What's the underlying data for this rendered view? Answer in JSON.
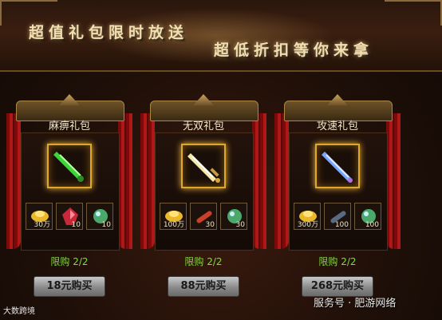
{
  "banner": {
    "line1": "超值礼包限时放送",
    "line2": "超低折扣等你来拿"
  },
  "packs": [
    {
      "name": "麻痹礼包",
      "items": [
        {
          "icon": "gold-ingot",
          "count": "30万"
        },
        {
          "icon": "red-gem",
          "count": "10"
        },
        {
          "icon": "orb",
          "count": "10"
        }
      ],
      "limit": "限购 2/2",
      "price": "18元购买",
      "accent": "#3cd43c"
    },
    {
      "name": "无双礼包",
      "items": [
        {
          "icon": "gold-ingot",
          "count": "100万"
        },
        {
          "icon": "red-stick",
          "count": "30"
        },
        {
          "icon": "orb",
          "count": "30"
        }
      ],
      "limit": "限购 2/2",
      "price": "88元购买",
      "accent": "#f6e6a8"
    },
    {
      "name": "攻速礼包",
      "items": [
        {
          "icon": "gold-ingot",
          "count": "300万"
        },
        {
          "icon": "dark-stick",
          "count": "100"
        },
        {
          "icon": "orb",
          "count": "100"
        }
      ],
      "limit": "限购 2/2",
      "price": "268元购买",
      "accent": "#7aa8ff"
    }
  ],
  "watermark": {
    "left": "大数跨境",
    "right": "服务号 · 肥游网络"
  }
}
